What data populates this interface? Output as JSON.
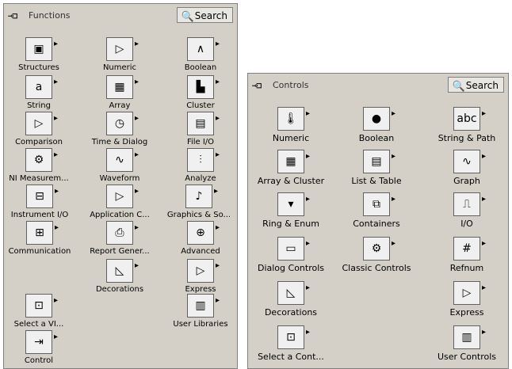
{
  "functions": {
    "title": "Functions",
    "search": "Search",
    "items": [
      "Structures",
      "Numeric",
      "Boolean",
      "String",
      "Array",
      "Cluster",
      "Comparison",
      "Time & Dialog",
      "File I/O",
      "NI Measurem...",
      "Waveform",
      "Analyze",
      "Instrument I/O",
      "Application C...",
      "Graphics & So...",
      "Communication",
      "Report Gener...",
      "Advanced",
      "Decorations",
      "Express",
      "Select a VI...",
      "User Libraries",
      "Control"
    ]
  },
  "controls": {
    "title": "Controls",
    "search": "Search",
    "items": [
      "Numeric",
      "Boolean",
      "String & Path",
      "Array & Cluster",
      "List & Table",
      "Graph",
      "Ring & Enum",
      "Containers",
      "I/O",
      "Dialog Controls",
      "Classic Controls",
      "Refnum",
      "Decorations",
      "Express",
      "Select a Cont...",
      "User Controls"
    ]
  }
}
